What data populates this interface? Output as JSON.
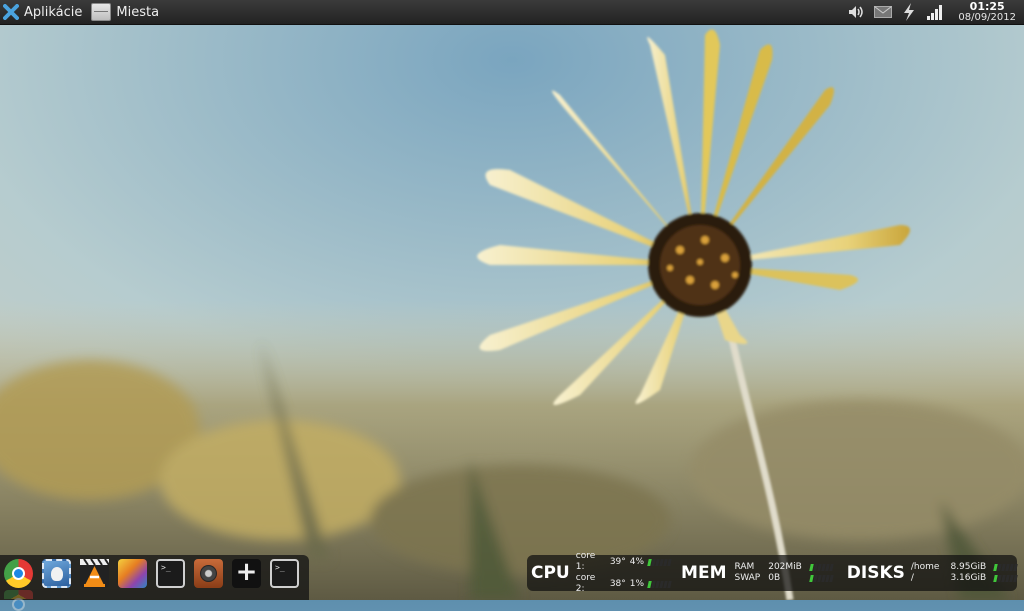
{
  "top_panel": {
    "applications_label": "Aplikácie",
    "places_label": "Miesta",
    "clock": {
      "time": "01:25",
      "date": "08/09/2012"
    }
  },
  "tray_icons": [
    "volume-icon",
    "mail-icon",
    "power-icon",
    "network-signal-icon"
  ],
  "dock": {
    "items": [
      {
        "name": "chrome-icon"
      },
      {
        "name": "thunderbird-icon"
      },
      {
        "name": "vlc-icon"
      },
      {
        "name": "gimp-icon"
      },
      {
        "name": "terminal-icon",
        "prompt": ">_"
      },
      {
        "name": "speaker-icon"
      },
      {
        "name": "add-icon",
        "glyph": "+"
      },
      {
        "name": "terminal-icon",
        "prompt": ">_"
      }
    ]
  },
  "conky": {
    "cpu": {
      "title": "CPU",
      "cores": [
        {
          "label": "core 1:",
          "temp": "39°",
          "usage": "4%",
          "level": 0.04
        },
        {
          "label": "core 2:",
          "temp": "38°",
          "usage": "1%",
          "level": 0.01
        }
      ]
    },
    "mem": {
      "title": "MEM",
      "rows": [
        {
          "label": "RAM",
          "value": "202MiB",
          "level": 0.1
        },
        {
          "label": "SWAP",
          "value": "0B",
          "level": 0.0
        }
      ]
    },
    "disks": {
      "title": "DISKS",
      "rows": [
        {
          "label": "/home",
          "value": "8.95GiB",
          "level": 0.1
        },
        {
          "label": "/",
          "value": "3.16GiB",
          "level": 0.1
        }
      ]
    },
    "bar_color": "#40c83b"
  }
}
